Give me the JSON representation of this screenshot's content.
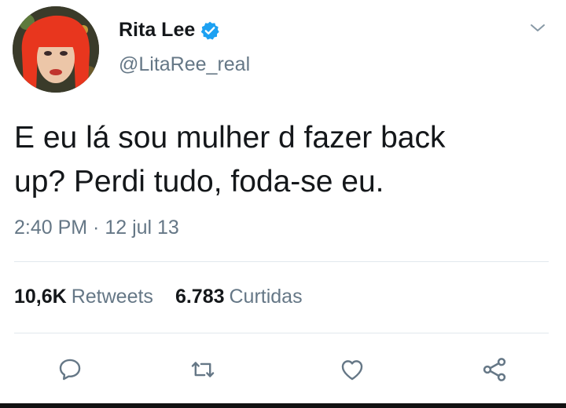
{
  "user": {
    "display_name": "Rita Lee",
    "handle": "@LitaRee_real",
    "verified": true
  },
  "tweet": {
    "text": "E eu lá sou mulher d fazer back\nup? Perdi tudo, foda-se eu.",
    "timestamp": "2:40 PM · 12 jul 13"
  },
  "stats": {
    "retweets_value": "10,6K",
    "retweets_label": "Retweets",
    "likes_value": "6.783",
    "likes_label": "Curtidas"
  },
  "icons": {
    "reply": "reply-icon",
    "retweet": "retweet-icon",
    "like": "heart-icon",
    "share": "share-icon",
    "menu": "chevron-down-icon",
    "verified": "verified-badge-icon"
  },
  "colors": {
    "text": "#14171a",
    "secondary": "#657786",
    "verified": "#1da1f2",
    "divider": "#e1e8ed"
  }
}
